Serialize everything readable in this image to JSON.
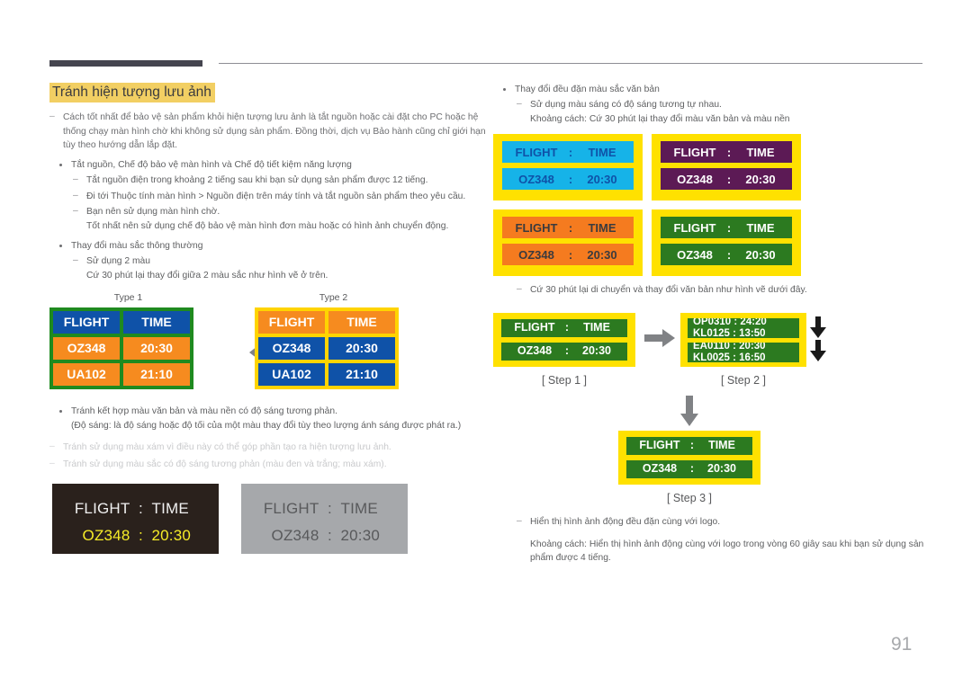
{
  "page": {
    "number": "91"
  },
  "left": {
    "section_title": "Tránh hiện tượng lưu ảnh",
    "note1": "Cách tốt nhất để bảo vệ sản phẩm khỏi hiện tượng lưu ảnh là tắt nguồn hoặc cài đặt cho PC hoặc hệ thống chạy màn hình chờ khi không sử dụng sản phẩm. Đồng thời, dịch vụ Bảo hành cũng chỉ giới hạn tùy theo hướng dẫn lắp đặt.",
    "bullet1": "Tắt nguồn, Chế độ bảo vệ màn hình và Chế độ tiết kiệm năng lượng",
    "bullet1_dash1": "Tắt nguồn điện trong khoảng 2 tiếng sau khi bạn sử dụng sản phẩm được 12 tiếng.",
    "bullet1_dash2": "Đi tới Thuộc tính màn hình > Nguồn điện trên máy tính và tắt nguồn sản phẩm theo yêu cầu.",
    "bullet1_dash3": "Bạn nên sử dụng màn hình chờ.",
    "bullet1_dash3_cont": "Tốt nhất nên sử dụng chế độ bảo vệ màn hình đơn màu hoặc có hình ảnh chuyển động.",
    "bullet2": "Thay đổi màu sắc thông thường",
    "bullet2_dash1": "Sử dụng 2 màu",
    "bullet2_dash1_cont": "Cứ 30 phút lại thay đổi giữa 2 màu sắc như hình vẽ ở trên.",
    "type1_label": "Type 1",
    "type2_label": "Type 2",
    "board_rows": [
      {
        "flight": "FLIGHT",
        "time": "TIME"
      },
      {
        "flight": "OZ348",
        "time": "20:30"
      },
      {
        "flight": "UA102",
        "time": "21:10"
      }
    ],
    "bullet3": "Tránh kết hợp màu văn bản và màu nền có độ sáng tương phản.",
    "bullet3_cont": "(Độ sáng: là độ sáng hoặc độ tối của một màu thay đổi tùy theo lượng ánh sáng được phát ra.)",
    "note2": "Tránh sử dụng màu xám vì điều này có thể góp phần tạo ra hiện tượng lưu ảnh.",
    "note3": "Tránh sử dụng màu sắc có độ sáng tương phản (màu đen và trắng; màu xám).",
    "panel_dark": {
      "row1_label": "FLIGHT",
      "row1_sep": ":",
      "row1_value": "TIME",
      "row2_label": "OZ348",
      "row2_sep": ":",
      "row2_value": "20:30"
    },
    "panel_gray": {
      "row1_label": "FLIGHT",
      "row1_sep": ":",
      "row1_value": "TIME",
      "row2_label": "OZ348",
      "row2_sep": ":",
      "row2_value": "20:30"
    }
  },
  "right": {
    "bullet1": "Thay đổi đều đặn màu sắc văn bản",
    "bullet1_dash1": "Sử dụng màu sáng có độ sáng tương tự nhau.",
    "bullet1_dash1_cont": "Khoảng cách: Cứ 30 phút lại thay đổi màu văn bản và màu nền",
    "quad": [
      {
        "label": "FLIGHT",
        "sep": ":",
        "value": "TIME",
        "label2": "OZ348",
        "sep2": ":",
        "value2": "20:30"
      },
      {
        "label": "FLIGHT",
        "sep": ":",
        "value": "TIME",
        "label2": "OZ348",
        "sep2": ":",
        "value2": "20:30"
      },
      {
        "label": "FLIGHT",
        "sep": ":",
        "value": "TIME",
        "label2": "OZ348",
        "sep2": ":",
        "value2": "20:30"
      },
      {
        "label": "FLIGHT",
        "sep": ":",
        "value": "TIME",
        "label2": "OZ348",
        "sep2": ":",
        "value2": "20:30"
      }
    ],
    "dash_move": "Cứ 30 phút lại di chuyển và thay đổi văn bản như hình vẽ dưới đây.",
    "step1": {
      "row1_label": "FLIGHT",
      "row1_sep": ":",
      "row1_value": "TIME",
      "row2_label": "OZ348",
      "row2_sep": ":",
      "row2_value": "20:30",
      "caption": "[ Step 1 ]"
    },
    "step2": {
      "strip1_line1": "OP0310 :  24:20",
      "strip1_line2": "KL0125 :  13:50",
      "strip2_line1": "EA0110 :  20:30",
      "strip2_line2": "KL0025 :  16:50",
      "caption": "[ Step 2 ]"
    },
    "step3": {
      "row1_label": "FLIGHT",
      "row1_sep": ":",
      "row1_value": "TIME",
      "row2_label": "OZ348",
      "row2_sep": ":",
      "row2_value": "20:30",
      "caption": "[ Step 3 ]"
    },
    "dash_logo": "Hiển thị hình ảnh động đều đặn cùng với logo.",
    "dash_logo_cont": "Khoảng cách: Hiển thị hình ảnh động cùng với logo trong vòng 60 giây sau khi bạn sử dụng sản phẩm được 4 tiếng."
  },
  "colors": {
    "title_highlight": "#f2cf63",
    "header_bar": "#45454f",
    "board_green_border": "#1f8a1f",
    "board_yellow_border": "#ffd400",
    "board_blue": "#0f52a8",
    "board_orange": "#f68b1f",
    "panel_yellow": "#ffe100",
    "panel_cyan": "#16b3e8",
    "panel_purple": "#5c1a55",
    "panel_orange": "#f57b1f",
    "panel_green": "#2c7a20",
    "panel_dark": "#2a211c",
    "panel_gray": "#a6a8ab",
    "yellow_text": "#f6ec28",
    "arrow_gray": "#808285"
  }
}
